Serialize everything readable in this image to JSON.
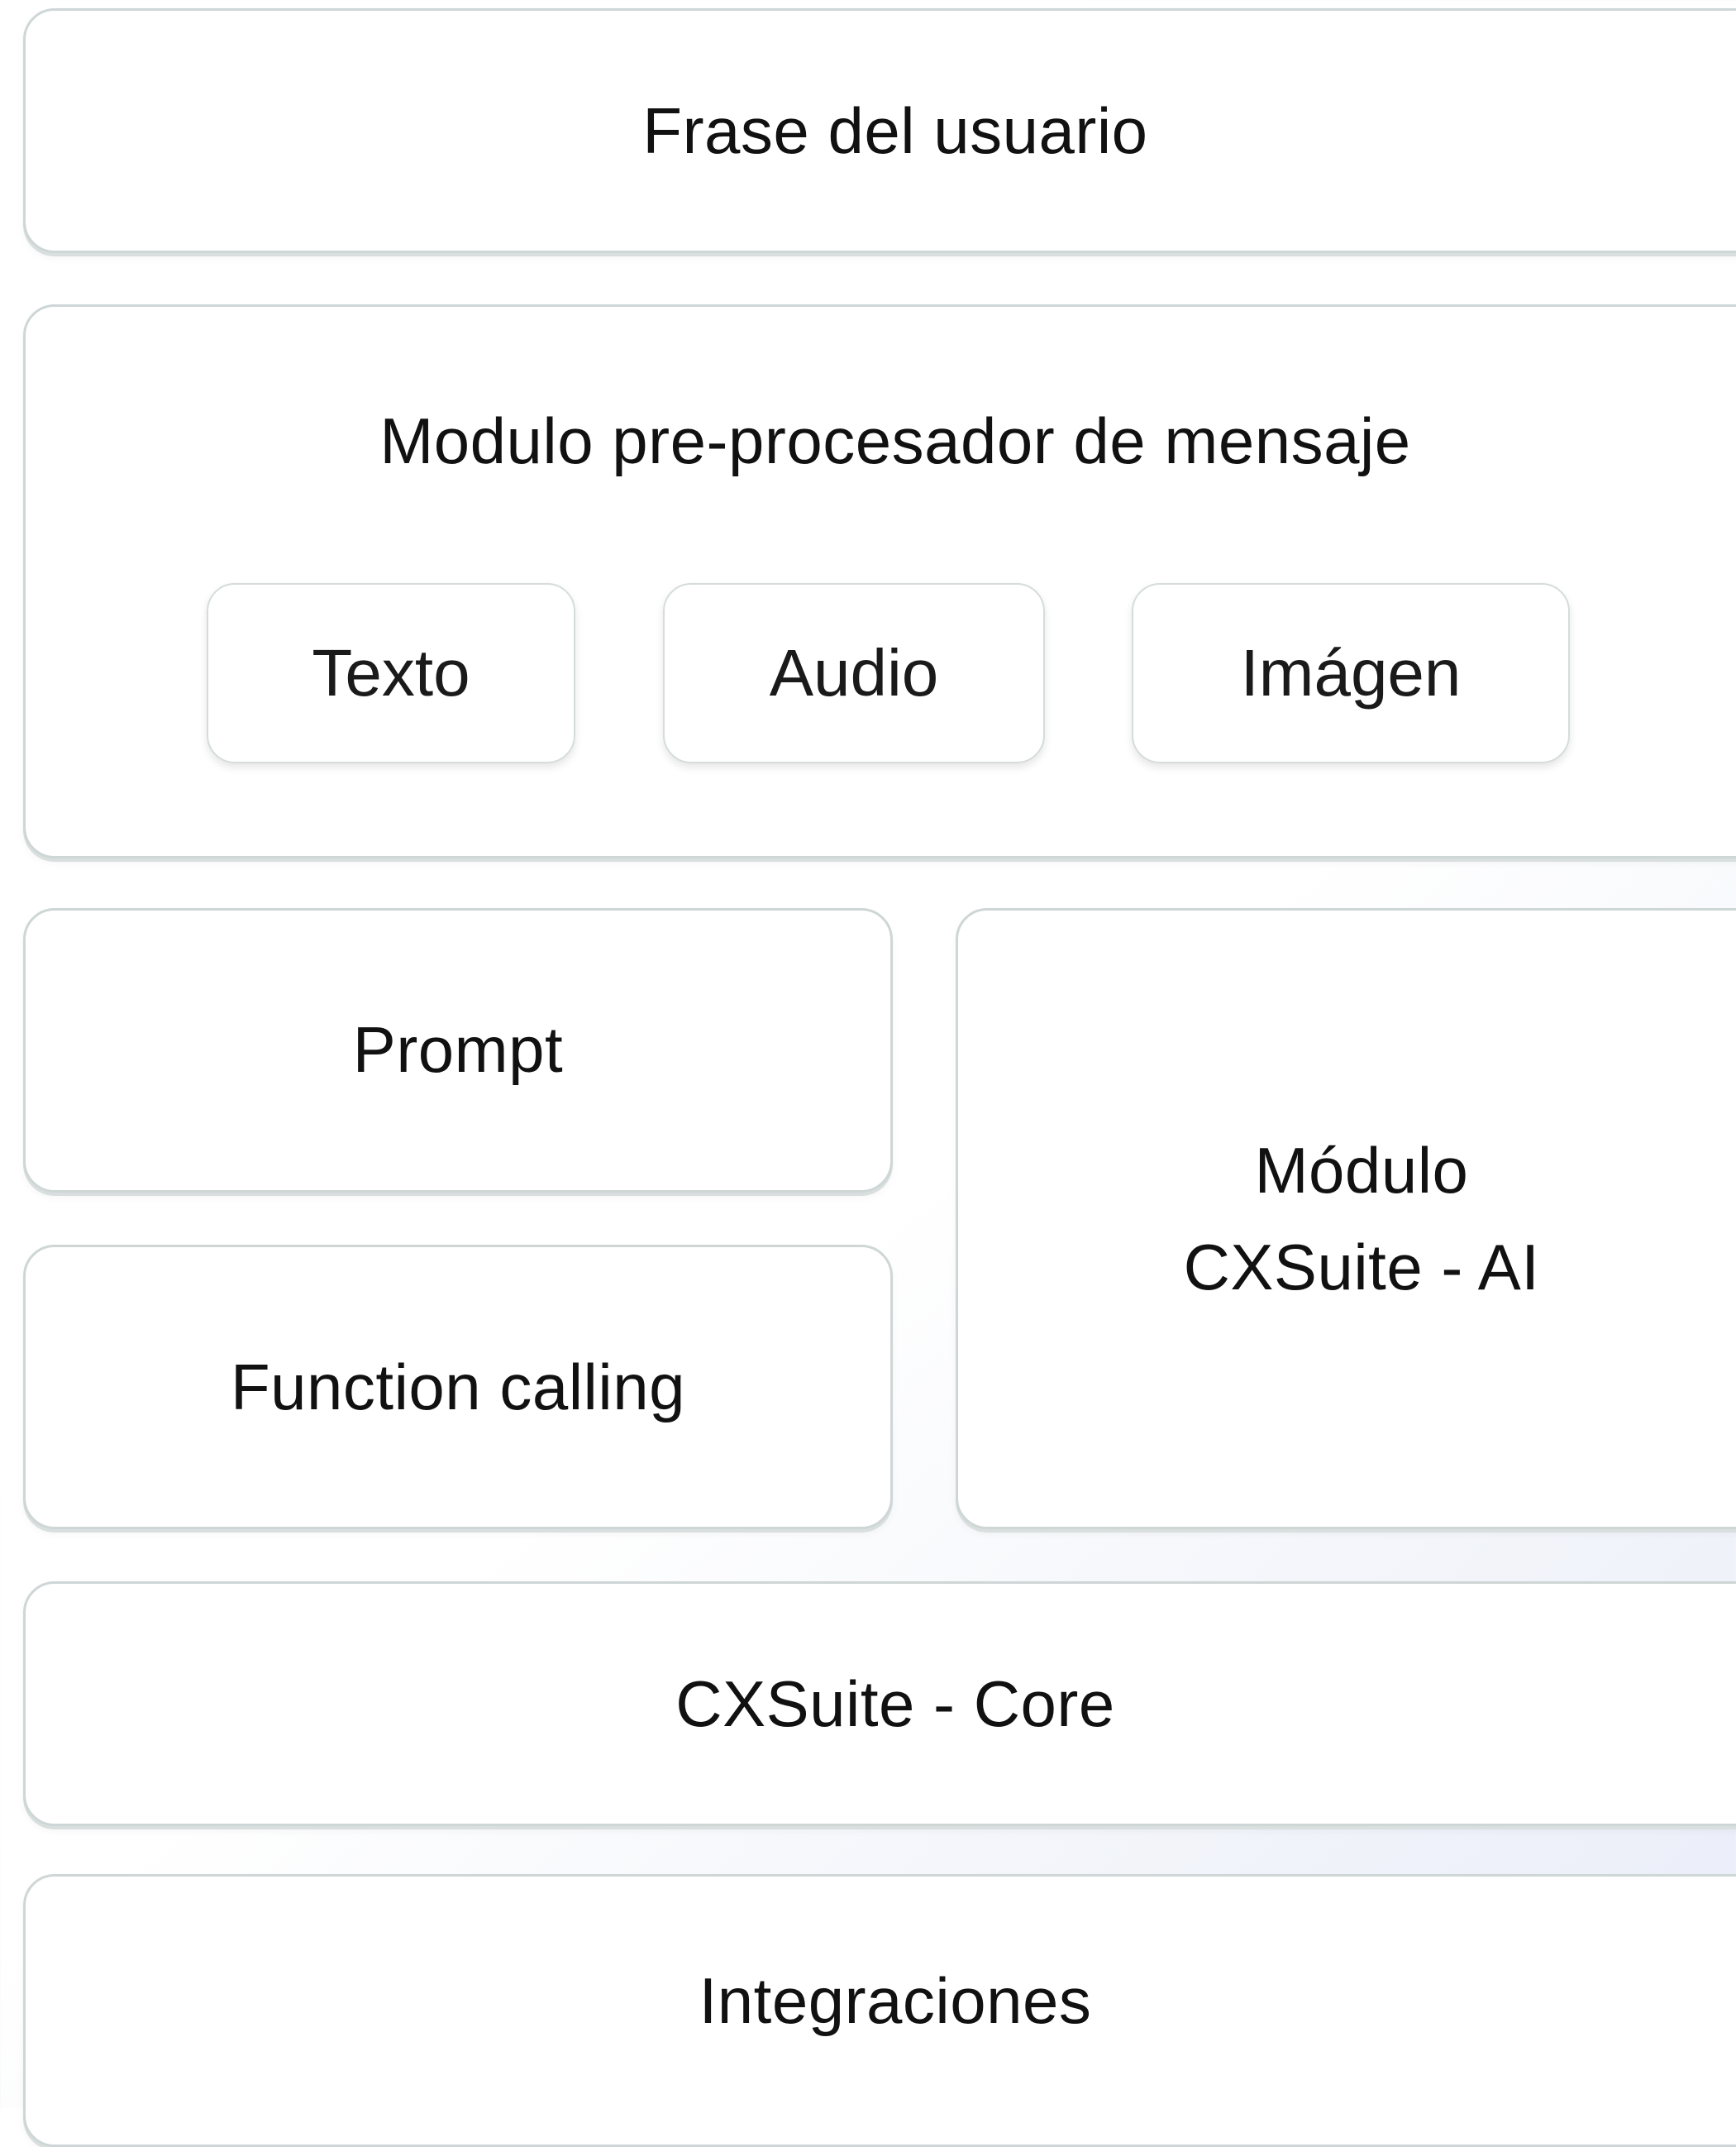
{
  "diagram": {
    "user_phrase": "Frase del usuario",
    "preprocessor": {
      "title": "Modulo pre-procesador de mensaje",
      "inputs": [
        "Texto",
        "Audio",
        "Imágen"
      ]
    },
    "prompt": "Prompt",
    "function_calling": "Function calling",
    "ai_module": {
      "line1": "Módulo",
      "line2": "CXSuite - AI"
    },
    "core": "CXSuite - Core",
    "integrations": "Integraciones"
  }
}
